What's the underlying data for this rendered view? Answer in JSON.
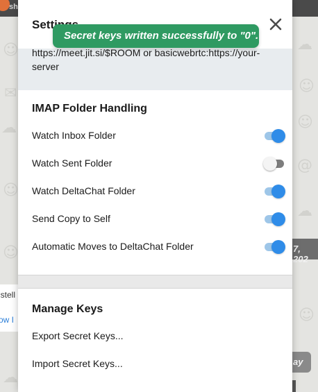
{
  "background": {
    "user_name_fragment": "sh",
    "contact_name_fragment": "istell",
    "contact_link_fragment": "ow I",
    "date_fragment": "7, 202",
    "button_fragment": "ay"
  },
  "settings": {
    "title": "Settings",
    "close_icon": "close-icon",
    "video_chat_help": "https://meet.jit.si/$ROOM or basicwebrtc:https://your-server",
    "imap_section_title": "IMAP Folder Handling",
    "imap_settings": [
      {
        "label": "Watch Inbox Folder",
        "enabled": true
      },
      {
        "label": "Watch Sent Folder",
        "enabled": false
      },
      {
        "label": "Watch DeltaChat Folder",
        "enabled": true
      },
      {
        "label": "Send Copy to Self",
        "enabled": true
      },
      {
        "label": "Automatic Moves to DeltaChat Folder",
        "enabled": true
      }
    ],
    "keys_section_title": "Manage Keys",
    "export_keys_label": "Export Secret Keys...",
    "import_keys_label": "Import Secret Keys..."
  },
  "toast": {
    "message": "Secret keys written successfully to \"0\"."
  },
  "colors": {
    "toggle_on": "#2f8ce8",
    "toggle_on_track": "#9ec6e8",
    "toggle_off_track": "#7d7d7d",
    "toast_bg": "#2f9a62"
  }
}
